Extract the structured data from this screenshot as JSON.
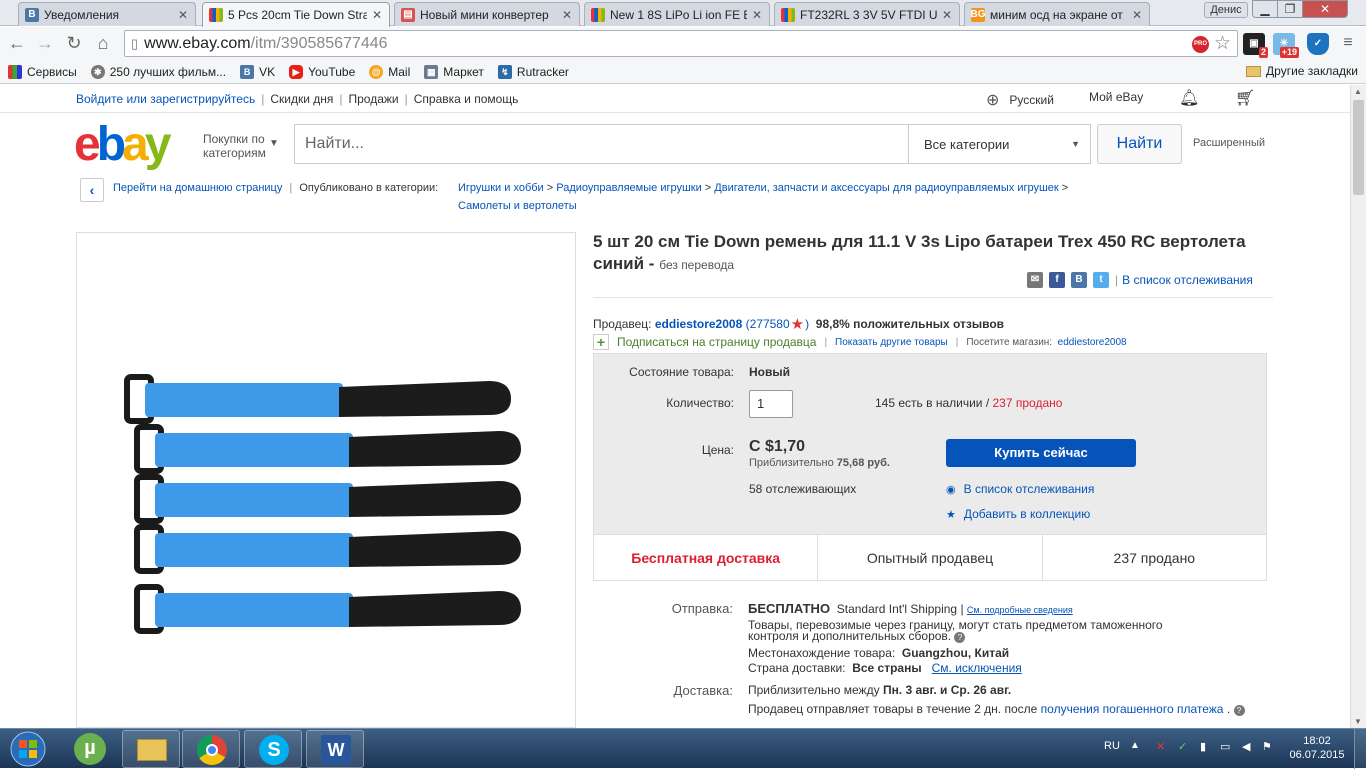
{
  "browser": {
    "tabs": [
      {
        "title": "Уведомления",
        "favicon": "vk-icon",
        "color": "#4a76a8"
      },
      {
        "title": "5 Pcs 20cm Tie Down Stra",
        "favicon": "ebay-icon",
        "color": "#e53238"
      },
      {
        "title": "Новый мини конвертер",
        "favicon": "cart-icon",
        "color": "#d9534f"
      },
      {
        "title": "New 1 8S LiPo Li ion FE B",
        "favicon": "ebay-icon",
        "color": "#e53238"
      },
      {
        "title": "FT232RL 3 3V 5V FTDI US",
        "favicon": "ebay-icon",
        "color": "#e53238"
      },
      {
        "title": "миним осд на экране от",
        "favicon": "bg-icon",
        "color": "#f6921e"
      }
    ],
    "user_name": "Денис",
    "url_host": "www.ebay.com",
    "url_path": "/itm/390585677446",
    "ext_badge_1": "2",
    "ext_badge_2": "+19",
    "bookmarks": [
      {
        "label": "Сервисы",
        "icon": "apps-icon"
      },
      {
        "label": "250 лучших фильм...",
        "icon": "film-icon"
      },
      {
        "label": "VK",
        "icon": "vk-icon"
      },
      {
        "label": "YouTube",
        "icon": "youtube-icon"
      },
      {
        "label": "Mail",
        "icon": "mail-icon"
      },
      {
        "label": "Маркет",
        "icon": "market-icon"
      },
      {
        "label": "Rutracker",
        "icon": "rutracker-icon"
      }
    ],
    "other_bookmarks": "Другие закладки"
  },
  "ebay": {
    "global_header": {
      "sign_in": "Войдите или зарегистрируйтесь",
      "deals": "Скидки дня",
      "sell": "Продажи",
      "help": "Справка и помощь",
      "language": "Русский",
      "my_ebay": "Мой eBay"
    },
    "browse_categories": "Покупки по категориям",
    "search_placeholder": "Найти...",
    "category_select": "Все категории",
    "search_button": "Найти",
    "advanced": "Расширенный",
    "breadcrumb": {
      "back_home": "Перейти на домашнюю страницу",
      "published_in": "Опубликовано в категории:",
      "items": [
        "Игрушки и хобби",
        "Радиоуправляемые игрушки",
        "Двигатели, запчасти и аксессуары для радиоуправляемых игрушек",
        "Самолеты и вертолеты"
      ]
    },
    "item": {
      "title": "5 шт 20 см Tie Down ремень для 11.1 V 3s Lipo батареи Trex 450 RC вертолета синий -",
      "no_translation": "без перевода",
      "watch_list": "В список отслеживания",
      "seller_label": "Продавец:",
      "seller_name": "eddiestore2008",
      "seller_score": "277580",
      "positive": "98,8% положительных отзывов",
      "subscribe": "Подписаться на страницу продавца",
      "other_items": "Показать другие товары",
      "visit_store": "Посетите магазин:",
      "store_name": "eddiestore2008",
      "condition_label": "Состояние товара:",
      "condition": "Новый",
      "quantity_label": "Количество:",
      "quantity": "1",
      "available": "145 есть в наличии /",
      "sold_red": "237 продано",
      "price_label": "Цена:",
      "price": "C $1,70",
      "approx_prefix": "Приблизительно",
      "approx_value": "75,68 руб.",
      "watchers": "58 отслеживающих",
      "buy_now": "Купить сейчас",
      "add_watch": "В список отслеживания",
      "add_collection": "Добавить в коллекцию",
      "badge_free_shipping": "Бесплатная доставка",
      "badge_experienced": "Опытный продавец",
      "badge_sold": "237 продано"
    },
    "shipping": {
      "label": "Отправка:",
      "free": "БЕСПЛАТНО",
      "service": "Standard Int'l Shipping |",
      "details_link": "См. подробные сведения",
      "customs_note": "Товары, перевозимые через границу, могут стать предметом таможенного контроля и дополнительных сборов.",
      "location_label": "Местонахождение товара:",
      "location": "Guangzhou, Китай",
      "countries_label": "Страна доставки:",
      "countries": "Все страны",
      "exceptions_link": "См. исключения"
    },
    "delivery": {
      "label": "Доставка:",
      "prefix": "Приблизительно между",
      "range": "Пн. 3 авг. и Ср. 26 авг.",
      "note": "Продавец отправляет товары в течение 2 дн. после",
      "note_link": "получения погашенного платежа"
    }
  },
  "taskbar": {
    "lang": "RU",
    "time": "18:02",
    "date": "06.07.2015"
  },
  "colors": {
    "ebay_blue": "#0654ba",
    "ebay_red": "#e53238",
    "strap_blue": "#3d9ae8"
  }
}
